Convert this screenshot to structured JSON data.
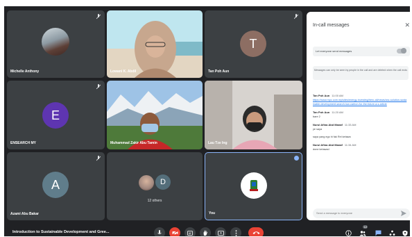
{
  "participants": [
    {
      "name": "Michelle Anthony",
      "kind": "photo-avatar"
    },
    {
      "name": "Lowani K. Abdil",
      "kind": "video"
    },
    {
      "name": "Tan Poh Aun",
      "kind": "letter",
      "letter": "T",
      "color": "#8d6e63"
    },
    {
      "name": "ENSEARCH MY",
      "kind": "letter",
      "letter": "E",
      "color": "#5e35b1"
    },
    {
      "name": "Muhammad Zakir Abu Tamin",
      "kind": "video"
    },
    {
      "name": "Lau Tze Ing",
      "kind": "video"
    },
    {
      "name": "Azami Abu Bakar",
      "kind": "letter",
      "letter": "A",
      "color": "#607d8b"
    },
    {
      "name": "",
      "kind": "others",
      "others_label": "12 others",
      "letter": "D"
    },
    {
      "name": "You",
      "kind": "logo"
    }
  ],
  "chat": {
    "title": "In-call messages",
    "toggle_label": "Let everyone send messages",
    "notice": "Messages can only be seen by people in the call and are deleted when the call ends",
    "messages": [
      {
        "sender": "Tan Poh Aun",
        "time": "11:00 AM",
        "link": "https://www.mpc.com.my/sites/energy-investing/hero-all/news/anc-solution-sustainable-development-search-low-carbon-for-the-future-a-s-article"
      },
      {
        "sender": "Tan Poh Aun",
        "time": "11:20 AM",
        "text": "bare 2"
      },
      {
        "sender": "Nurul Afina Abd Manaf",
        "time": "11:33 AM",
        "text": "ye saya"
      },
      {
        "sender": "",
        "time": "",
        "text": "saya yang ego hi fak Rei ketawa"
      },
      {
        "sender": "Nurul Afina Abd Manaf",
        "time": "11:34 AM",
        "text": "done ketawad"
      }
    ],
    "input_placeholder": "Send a message to everyone"
  },
  "meeting_title": "Introduction to Sustainable Development and Gree...",
  "others_badge": "12",
  "colors": {
    "background": "#202124",
    "tile": "#3c4043",
    "end_call": "#ea4335",
    "link": "#1a73e8",
    "accent": "#8ab4f8"
  }
}
